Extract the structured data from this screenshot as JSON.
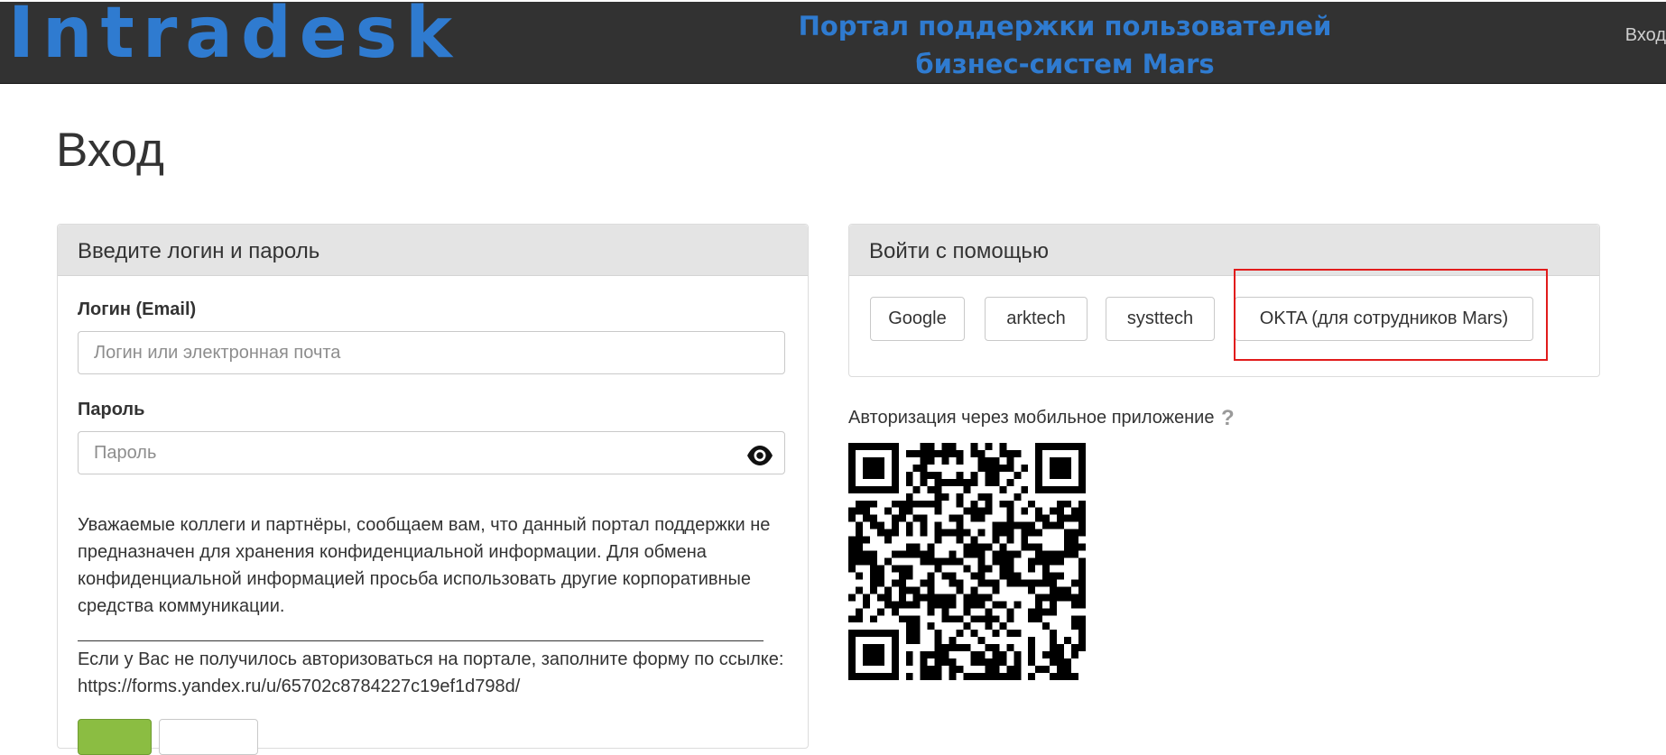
{
  "header": {
    "logo": "Intradesk",
    "portal_title_line1": "Портал поддержки пользователей",
    "portal_title_line2": "бизнес-систем Mars",
    "login_link": "Вход",
    "brand_color": "#2f7bd0"
  },
  "page_title": "Вход",
  "login_form": {
    "panel_title": "Введите логин и пароль",
    "login_label": "Логин (Email)",
    "login_placeholder": "Логин или электронная почта",
    "password_label": "Пароль",
    "password_placeholder": "Пароль",
    "show_password_icon": "eye-icon",
    "notice": "Уважаемые коллеги и партнёры, сообщаем вам, что данный портал поддержки не предназначен для хранения конфиденциальной информации. Для обмена конфиденциальной информацией просьба использовать другие корпоративные средства коммуникации.",
    "fallback_text": "Если у Вас не получилось авторизоваться на портале, заполните форму по ссылке: https://forms.yandex.ru/u/65702c8784227c19ef1d798d/"
  },
  "sso": {
    "panel_title": "Войти с помощью",
    "providers": [
      "Google",
      "arktech",
      "systtech",
      "OKTA (для сотрудников Mars)"
    ],
    "highlight_color": "#e11b1b"
  },
  "mobile_auth": {
    "label": "Авторизация через мобильное приложение",
    "help_icon": "?"
  }
}
